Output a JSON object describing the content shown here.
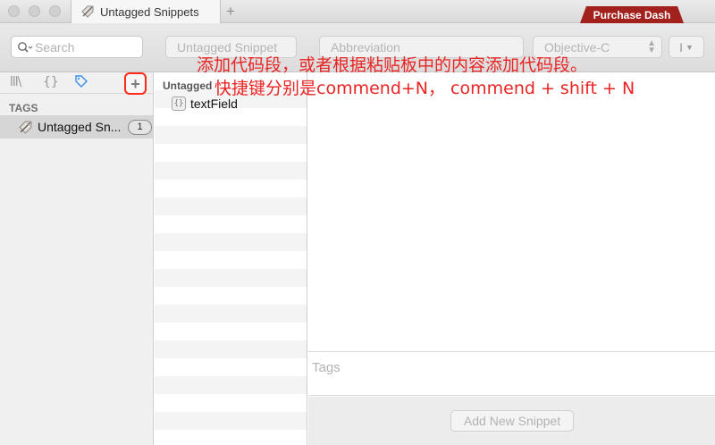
{
  "window": {
    "tab_title": "Untagged Snippets",
    "new_tab_symbol": "+",
    "purchase_label": "Purchase Dash"
  },
  "toolbar": {
    "search_placeholder": "Search",
    "snippet_name_placeholder": "Untagged Snippet",
    "abbreviation_placeholder": "Abbreviation",
    "language": "Objective-C",
    "cursor_symbol": "I"
  },
  "sidebar": {
    "tabs": [
      "library",
      "snippets",
      "tags"
    ],
    "add_symbol": "+",
    "section_header": "TAGS",
    "tags": [
      {
        "label": "Untagged Snippets",
        "display": "Untagged Sn...",
        "count": "1"
      }
    ]
  },
  "list": {
    "header": "Untagged",
    "items": [
      {
        "title": "textField"
      }
    ]
  },
  "editor": {
    "tags_placeholder": "Tags",
    "add_button": "Add New Snippet"
  },
  "annotation": {
    "line1": "添加代码段，或者根据粘贴板中的内容添加代码段。",
    "line2": "快捷键分别是commend+N， commend + shift + N"
  },
  "colors": {
    "annotation": "#ea2323",
    "purchase_bg": "#a2211c",
    "highlight_border": "#ff2a1a"
  }
}
